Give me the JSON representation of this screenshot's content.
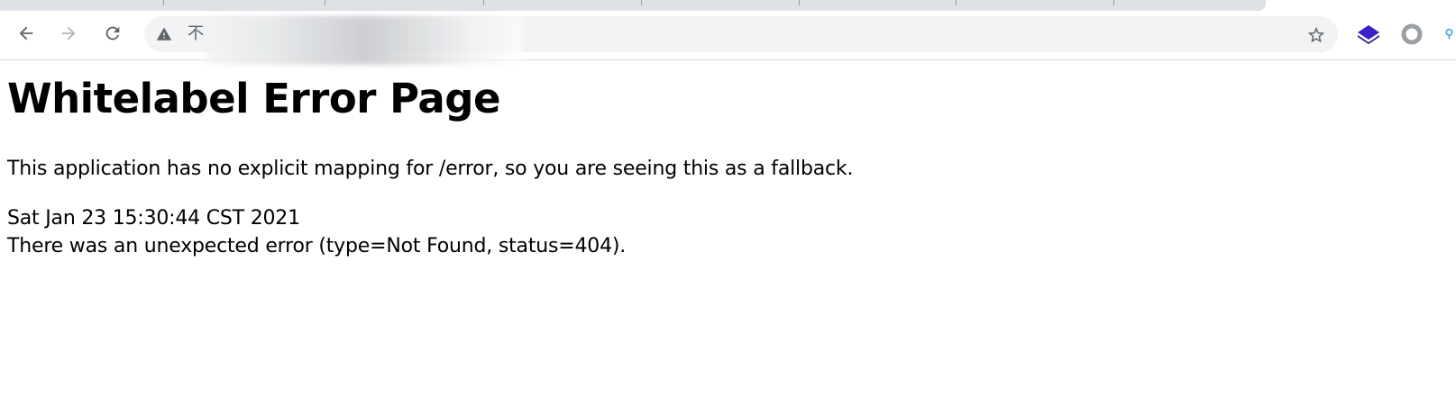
{
  "browser": {
    "address_bar": {
      "security_label": "不",
      "url": ""
    },
    "colors": {
      "tabstrip": "#dee1e6",
      "omnibox": "#f1f3f4",
      "icon": "#5f6368",
      "icon_disabled": "#b0b3b8",
      "extension_purple": "#3d1fc7"
    },
    "icons": [
      "back-arrow-icon",
      "forward-arrow-icon",
      "reload-icon",
      "not-secure-warning-icon",
      "bookmark-star-icon",
      "layers-extension-icon",
      "ring-extension-icon",
      "partial-extension-icon"
    ]
  },
  "page": {
    "title": "Whitelabel Error Page",
    "message": "This application has no explicit mapping for /error, so you are seeing this as a fallback.",
    "timestamp": "Sat Jan 23 15:30:44 CST 2021",
    "error_line": "There was an unexpected error (type=Not Found, status=404)."
  }
}
